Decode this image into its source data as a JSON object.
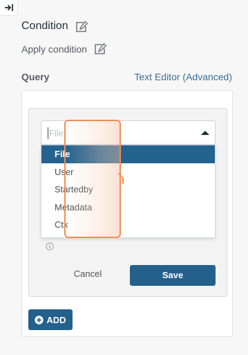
{
  "header": {
    "collapse_icon": "collapse-right-icon"
  },
  "condition": {
    "title": "Condition",
    "subtitle": "Apply condition",
    "edit_icon": "edit-icon"
  },
  "query": {
    "label": "Query",
    "editor_link": "Text Editor (Advanced)"
  },
  "select": {
    "placeholder": "File",
    "value": "",
    "expanded": true,
    "options": [
      "File",
      "User",
      "Startedby",
      "Metadata",
      "Ctx"
    ],
    "selected": "File"
  },
  "actions": {
    "cancel_label": "Cancel",
    "save_label": "Save",
    "add_label": "ADD"
  },
  "colors": {
    "primary": "#23608c",
    "highlight": "#f28c52",
    "link": "#3a6d91"
  }
}
